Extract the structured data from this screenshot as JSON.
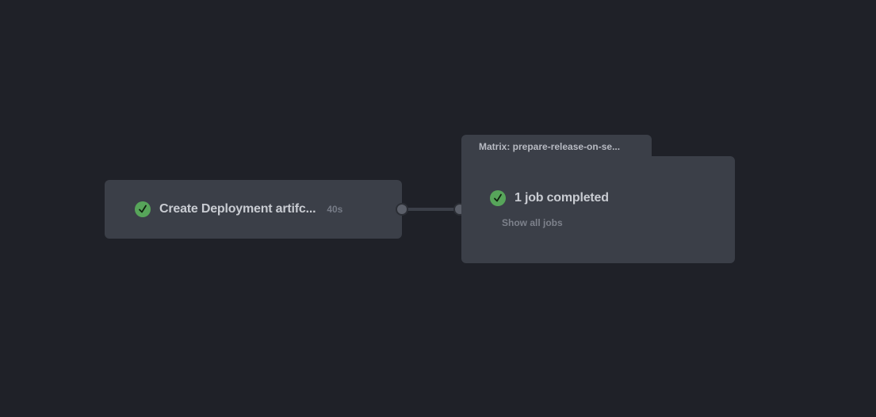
{
  "job": {
    "name": "Create Deployment artifc...",
    "duration": "40s",
    "status_icon": "check-circle-icon",
    "status_color": "#57a55a"
  },
  "matrix": {
    "title": "Matrix: prepare-release-on-se...",
    "summary": "1 job completed",
    "show_all_label": "Show all jobs",
    "status_icon": "check-circle-icon",
    "status_color": "#57a55a"
  },
  "colors": {
    "background": "#1f2128",
    "card": "#3b3f48"
  }
}
